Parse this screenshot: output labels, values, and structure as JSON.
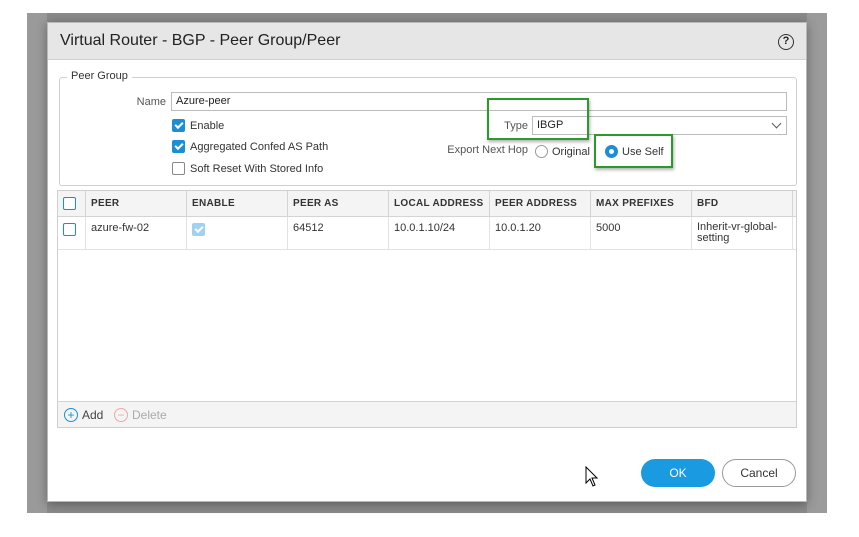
{
  "dialog": {
    "title": "Virtual Router - BGP - Peer Group/Peer",
    "help_icon": "question-circle-icon"
  },
  "peer_group": {
    "legend": "Peer Group",
    "name_label": "Name",
    "name_value": "Azure-peer",
    "enable_label": "Enable",
    "enable_checked": true,
    "aggregated_label": "Aggregated Confed AS Path",
    "aggregated_checked": true,
    "soft_reset_label": "Soft Reset With Stored Info",
    "soft_reset_checked": false,
    "type_label": "Type",
    "type_value": "IBGP",
    "export_next_hop_label": "Export Next Hop",
    "export_options": [
      {
        "label": "Original",
        "selected": false
      },
      {
        "label": "Use Self",
        "selected": true
      }
    ]
  },
  "peers_table": {
    "columns": [
      "PEER",
      "ENABLE",
      "PEER AS",
      "LOCAL ADDRESS",
      "PEER ADDRESS",
      "MAX PREFIXES",
      "BFD"
    ],
    "rows": [
      {
        "peer": "azure-fw-02",
        "enable": true,
        "peer_as": "64512",
        "local_address": "10.0.1.10/24",
        "peer_address": "10.0.1.20",
        "max_prefixes": "5000",
        "bfd": "Inherit-vr-global-setting"
      }
    ],
    "add_label": "Add",
    "delete_label": "Delete"
  },
  "buttons": {
    "ok_label": "OK",
    "cancel_label": "Cancel"
  },
  "colors": {
    "accent": "#1a9ae0",
    "highlight": "#2a9a2a"
  }
}
